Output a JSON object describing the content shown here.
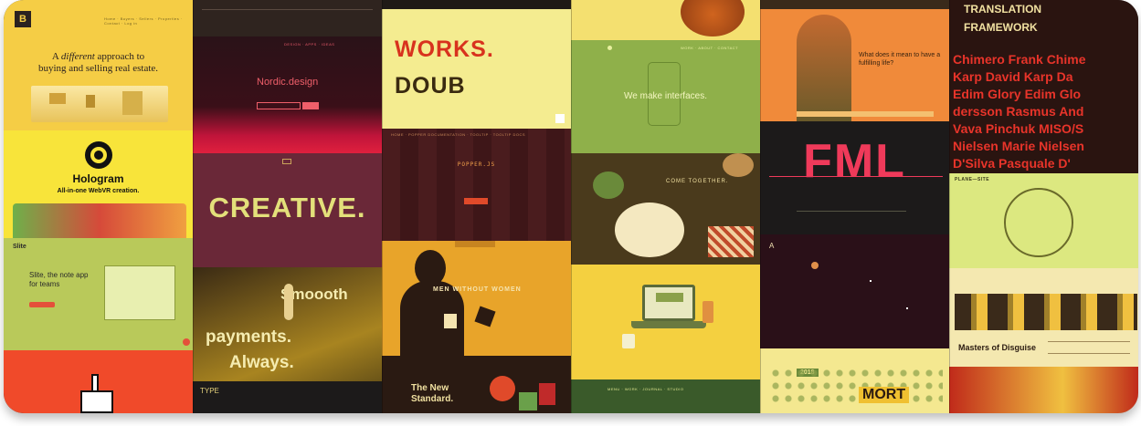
{
  "columns": {
    "c1": {
      "logo_letter": "B",
      "realestate_headline_pre": "A",
      "realestate_headline_em": "different",
      "realestate_headline_post": "approach to",
      "realestate_headline_line2": "buying and selling real estate.",
      "hologram_title": "Hologram",
      "hologram_subtitle": "All-in-one WebVR creation.",
      "slite_logo": "Slite",
      "slite_headline": "Slite, the note app for teams"
    },
    "c2": {
      "nordic_title": "Nordic.design",
      "creative_word": "CREATIVE.",
      "smooth_word": "Smoooth",
      "payments_word": "payments.",
      "always_word": "Always.",
      "type_logo": "TYPE"
    },
    "c3": {
      "works_word": "WORKS.",
      "doub_word": "DOUB",
      "popper_title": "POPPER.JS",
      "men_title": "MEN WITHOUT WOMEN",
      "standard_line1": "The New",
      "standard_line2": "Standard."
    },
    "c4": {
      "interfaces_text": "We make interfaces.",
      "come_together": "COME TOGETHER."
    },
    "c5": {
      "question_text": "What does it mean to have a fulfilling life?",
      "fml_word": "FML",
      "a_letter": "A",
      "year_badge": "2018",
      "mort_word": "MORT"
    },
    "c6": {
      "translation_line1": "TRANSLATION",
      "translation_line2": "FRAMEWORK",
      "speaker_rows": [
        "Chimero   Frank Chime",
        "Karp   David Karp   Da",
        "Edim   Glory Edim   Glo",
        "dersson   Rasmus And",
        "Vava Pinchuk   MISO/S",
        "Nielsen   Marie Nielsen",
        "D'Silva   Pasquale D'"
      ],
      "plane_site_logo": "PLANE—SITE",
      "masters_title": "Masters of Disguise"
    }
  },
  "colors": {
    "yellow": "#f2c23a",
    "mustard": "#e0b130",
    "olive": "#8fa84c",
    "maroon": "#5a1f2b",
    "red": "#e63c2a",
    "dark": "#2a1f1c"
  }
}
